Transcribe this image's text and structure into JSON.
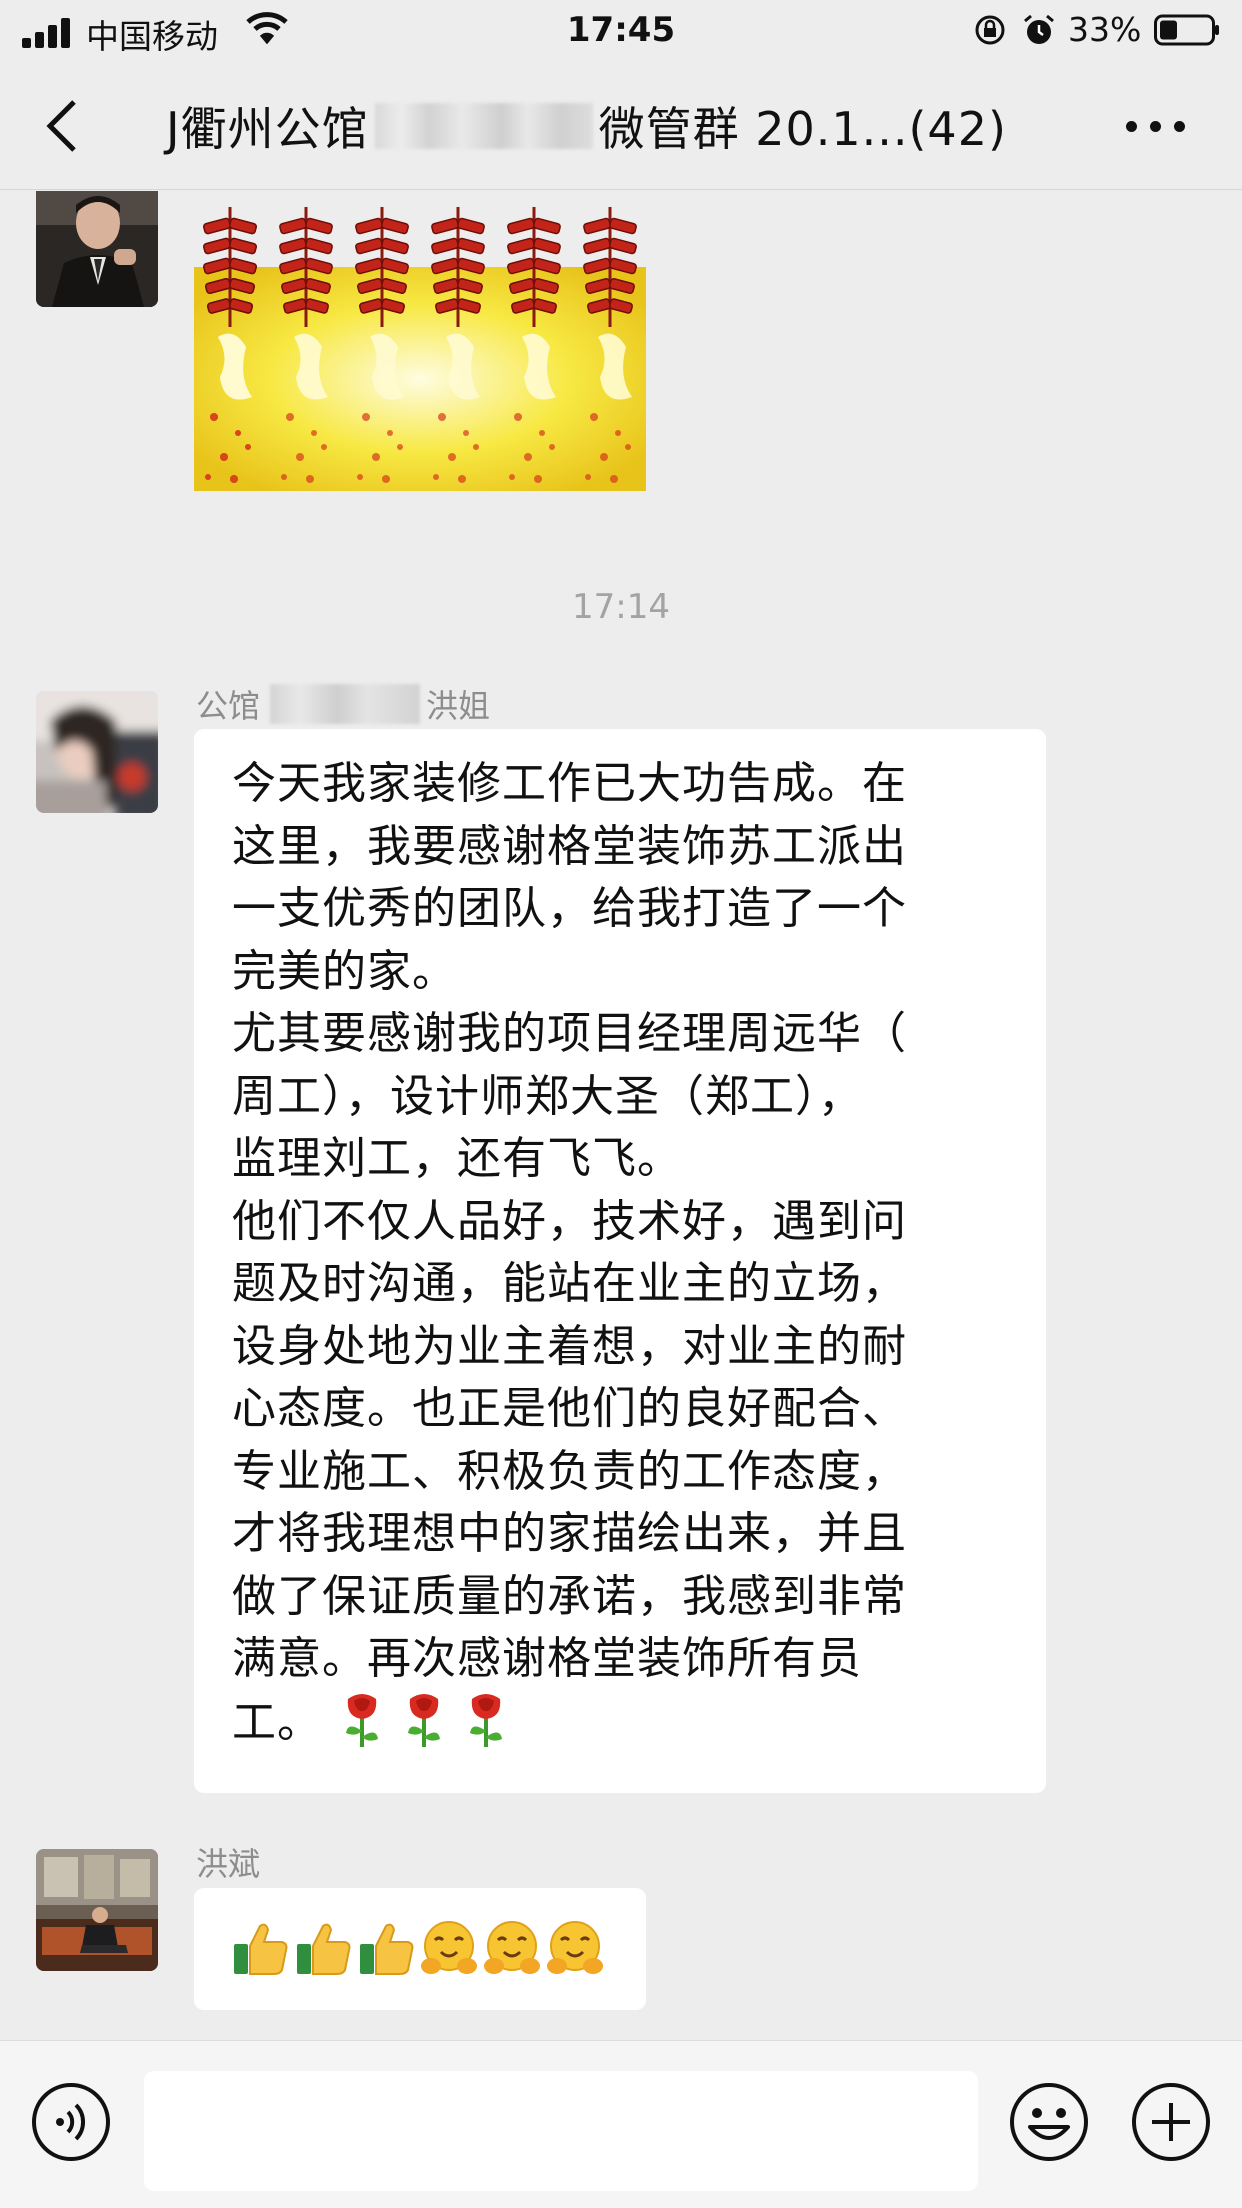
{
  "status_bar": {
    "carrier": "中国移动",
    "time": "17:45",
    "battery": "33%"
  },
  "nav": {
    "title_prefix": "J衢州公馆",
    "title_suffix": "微管群 20.1...(42)"
  },
  "chat": {
    "timestamp": "17:14",
    "messages": [
      {
        "sender_prefix": "公馆",
        "sender_suffix": "洪姐",
        "lines": [
          "今天我家装修工作已大功告成。在",
          "这里，我要感谢格堂装饰苏工派出",
          "一支优秀的团队，给我打造了一个",
          "完美的家。",
          "尤其要感谢我的项目经理周远华（",
          "周工），设计师郑大圣（郑工），",
          "监理刘工，还有飞飞。",
          "他们不仅人品好，技术好，遇到问",
          "题及时沟通，能站在业主的立场，",
          "设身处地为业主着想，对业主的耐",
          "心态度。也正是他们的良好配合、",
          "专业施工、积极负责的工作态度，",
          "才将我理想中的家描绘出来，并且",
          "做了保证质量的承诺，我感到非常",
          "满意。再次感谢格堂装饰所有员",
          "工。"
        ],
        "trailing_emoji": [
          "rose-icon",
          "rose-icon",
          "rose-icon"
        ]
      },
      {
        "sender": "洪斌",
        "emoji": [
          "thumbs-up-icon",
          "thumbs-up-icon",
          "thumbs-up-icon",
          "hug-face-icon",
          "hug-face-icon",
          "hug-face-icon"
        ]
      }
    ]
  },
  "input_bar": {
    "value": "",
    "icons": [
      "voice-icon",
      "smiley-icon",
      "plus-icon"
    ]
  },
  "colors": {
    "background": "#ededed",
    "bubble": "#ffffff",
    "meta_text": "#a3a3a3"
  }
}
